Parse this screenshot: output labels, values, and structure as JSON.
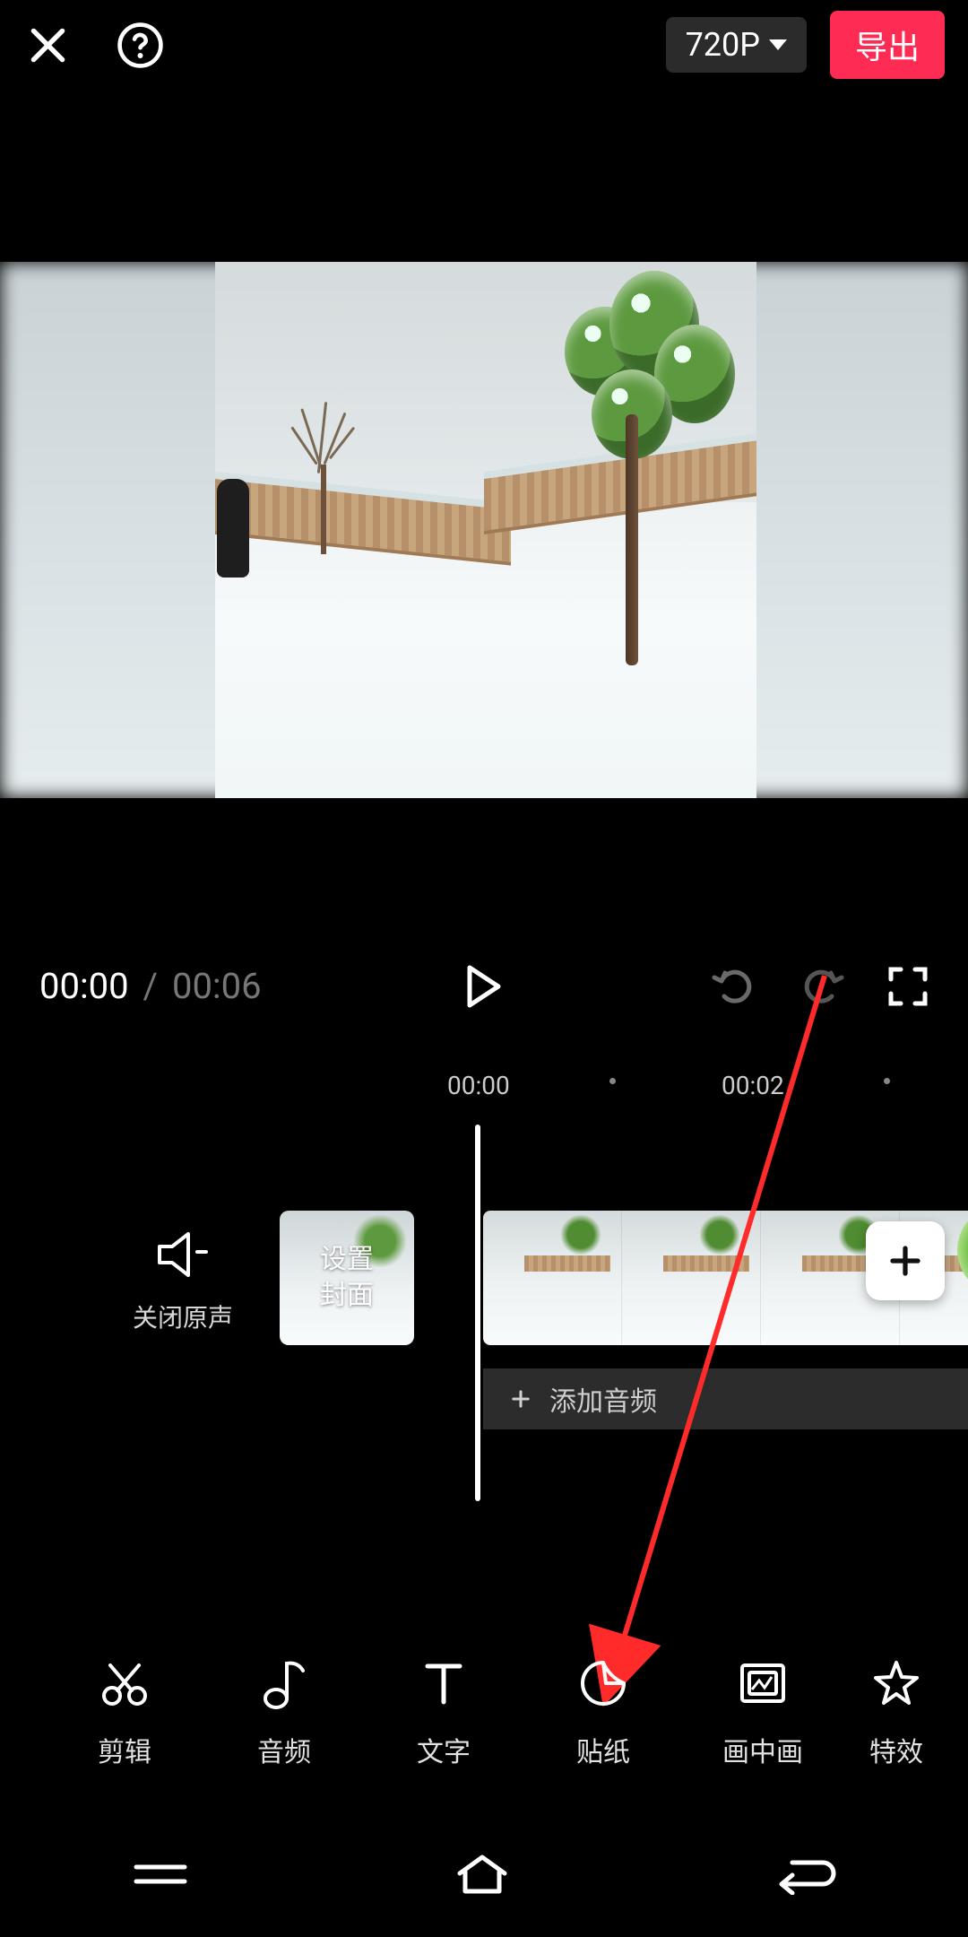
{
  "header": {
    "resolution_label": "720P",
    "export_label": "导出"
  },
  "playback": {
    "current": "00:00",
    "separator": "/",
    "total": "00:06"
  },
  "ruler": {
    "ticks": [
      "00:00",
      "00:02"
    ]
  },
  "timeline": {
    "mute_label": "关闭原声",
    "cover_label": "设置\n封面",
    "add_audio_label": "添加音频"
  },
  "tools": [
    {
      "key": "edit",
      "label": "剪辑"
    },
    {
      "key": "audio",
      "label": "音频"
    },
    {
      "key": "text",
      "label": "文字"
    },
    {
      "key": "sticker",
      "label": "贴纸"
    },
    {
      "key": "pip",
      "label": "画中画"
    },
    {
      "key": "effect",
      "label": "特效"
    }
  ],
  "colors": {
    "accent": "#fe2c55",
    "annotation": "#ff2a2a"
  }
}
